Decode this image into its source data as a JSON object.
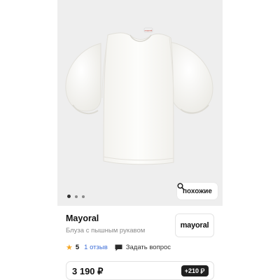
{
  "gallery": {
    "slides_total": 3,
    "active_slide": 1,
    "similar_label": "похожие",
    "similar_icon": "search-icon",
    "tag_text": "mayoral"
  },
  "product": {
    "brand": "Mayoral",
    "name": "Блуза с пышным рукавом",
    "brand_logo_text": "mayoral"
  },
  "meta": {
    "star_icon": "star-icon",
    "rating": "5",
    "reviews": "1 отзыв",
    "ask_icon": "chat-icon",
    "ask_label": "Задать вопрос"
  },
  "price": {
    "amount": "3 190 ₽",
    "bonus": "+210"
  },
  "colors": {
    "photo_bg": "#eeeeee",
    "garment": "#fbfaf6",
    "star": "#f5a623",
    "link": "#3f6fd8"
  }
}
